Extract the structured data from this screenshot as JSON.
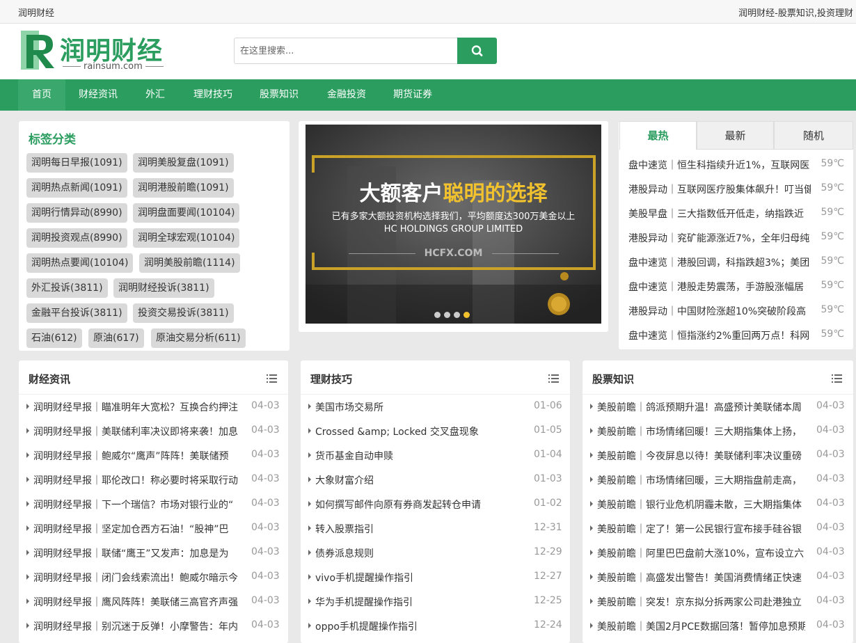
{
  "topbar": {
    "site_name": "润明财经",
    "slogan": "润明财经-股票知识,投资理财"
  },
  "logo": {
    "text": "润明财经",
    "sub": "rainsum.com"
  },
  "search": {
    "placeholder": "在这里搜索..."
  },
  "nav": [
    "首页",
    "财经资讯",
    "外汇",
    "理财技巧",
    "股票知识",
    "金融投资",
    "期货证券"
  ],
  "tags": {
    "title": "标签分类",
    "items": [
      "润明每日早报(1091)",
      "润明美股复盘(1091)",
      "润明热点新闻(1091)",
      "润明港股前瞻(1091)",
      "润明行情异动(8990)",
      "润明盘面要闻(10104)",
      "润明投资观点(8990)",
      "润明全球宏观(10104)",
      "润明热点要闻(10104)",
      "润明美股前瞻(1114)",
      "外汇投诉(3811)",
      "润明财经投诉(3811)",
      "金融平台投诉(3811)",
      "投资交易投诉(3811)",
      "石油(612)",
      "原油(617)",
      "原油交易分析(611)"
    ]
  },
  "banner": {
    "title_white": "大额客户",
    "title_gold": "聪明的选择",
    "subtitle": "已有多家大额投资机构选择我们，平均额度达300万美金以上",
    "company": "HC HOLDINGS GROUP LIMITED",
    "url": "HCFX.COM"
  },
  "hot": {
    "tabs": [
      "最热",
      "最新",
      "随机"
    ],
    "items": [
      {
        "title": "盘中速览｜恒生科指续升近1%，互联网医",
        "temp": "59℃"
      },
      {
        "title": "港股异动｜互联网医疗股集体飙升！叮当健",
        "temp": "59℃"
      },
      {
        "title": "美股早盘｜三大指数低开低走，纳指跌近",
        "temp": "59℃"
      },
      {
        "title": "港股异动｜兖矿能源涨近7%，全年归母纯",
        "temp": "59℃"
      },
      {
        "title": "盘中速览｜港股回调，科指跌超3%；美团",
        "temp": "59℃"
      },
      {
        "title": "盘中速览｜港股走势震荡，手游股涨幅居",
        "temp": "59℃"
      },
      {
        "title": "港股异动｜中国财险涨超10%突破阶段高",
        "temp": "59℃"
      },
      {
        "title": "盘中速览｜恒指涨约2%重回两万点！科网",
        "temp": "59℃"
      }
    ]
  },
  "columns": [
    {
      "title": "财经资讯",
      "items": [
        {
          "title": "润明财经早报｜瞄准明年大宽松？互换合约押注",
          "date": "04-03"
        },
        {
          "title": "润明财经早报｜美联储利率决议即将来袭！加息",
          "date": "04-03"
        },
        {
          "title": "润明财经早报｜鲍威尔“鹰声”阵阵！美联储预",
          "date": "04-03"
        },
        {
          "title": "润明财经早报｜耶伦改口！称必要时将采取行动",
          "date": "04-03"
        },
        {
          "title": "润明财经早报｜下一个瑞信？市场对银行业的“",
          "date": "04-03"
        },
        {
          "title": "润明财经早报｜坚定加仓西方石油！“股神”巴",
          "date": "04-03"
        },
        {
          "title": "润明财经早报｜联储“鹰王”又发声：加息是为",
          "date": "04-03"
        },
        {
          "title": "润明财经早报｜闭门会线索流出！鲍威尔暗示今",
          "date": "04-03"
        },
        {
          "title": "润明财经早报｜鹰风阵阵！美联储三高官齐声强",
          "date": "04-03"
        },
        {
          "title": "润明财经早报｜别沉迷于反弹！小摩警告：年内",
          "date": "04-03"
        }
      ]
    },
    {
      "title": "理财技巧",
      "items": [
        {
          "title": "美国市场交易所",
          "date": "01-06"
        },
        {
          "title": "Crossed &amp; Locked 交叉盘现象",
          "date": "01-05"
        },
        {
          "title": "货币基金自动申赎",
          "date": "01-04"
        },
        {
          "title": "大象财富介绍",
          "date": "01-03"
        },
        {
          "title": "如何撰写邮件向原有券商发起转仓申请",
          "date": "01-02"
        },
        {
          "title": "转入股票指引",
          "date": "12-31"
        },
        {
          "title": "债券派息规则",
          "date": "12-29"
        },
        {
          "title": "vivo手机提醒操作指引",
          "date": "12-27"
        },
        {
          "title": "华为手机提醒操作指引",
          "date": "12-25"
        },
        {
          "title": "oppo手机提醒操作指引",
          "date": "12-24"
        }
      ]
    },
    {
      "title": "股票知识",
      "items": [
        {
          "title": "美股前瞻｜鸽派预期升温！高盛预计美联储本周",
          "date": "04-03"
        },
        {
          "title": "美股前瞻｜市场情绪回暖！三大期指集体上扬，",
          "date": "04-03"
        },
        {
          "title": "美股前瞻｜今夜屏息以待！美联储利率决议重磅",
          "date": "04-03"
        },
        {
          "title": "美股前瞻｜市场情绪回暖，三大期指盘前走高，",
          "date": "04-03"
        },
        {
          "title": "美股前瞻｜银行业危机阴霾未散，三大期指集体",
          "date": "04-03"
        },
        {
          "title": "美股前瞻｜定了！第一公民银行宣布接手硅谷银",
          "date": "04-03"
        },
        {
          "title": "美股前瞻｜阿里巴巴盘前大涨10%，宣布设立六",
          "date": "04-03"
        },
        {
          "title": "美股前瞻｜高盛发出警告！美国消费情绪正快速",
          "date": "04-03"
        },
        {
          "title": "美股前瞻｜突发！京东拟分拆两家公司赴港独立",
          "date": "04-03"
        },
        {
          "title": "美股前瞻｜美国2月PCE数据回落！暂停加息预期",
          "date": "04-03"
        }
      ]
    }
  ]
}
